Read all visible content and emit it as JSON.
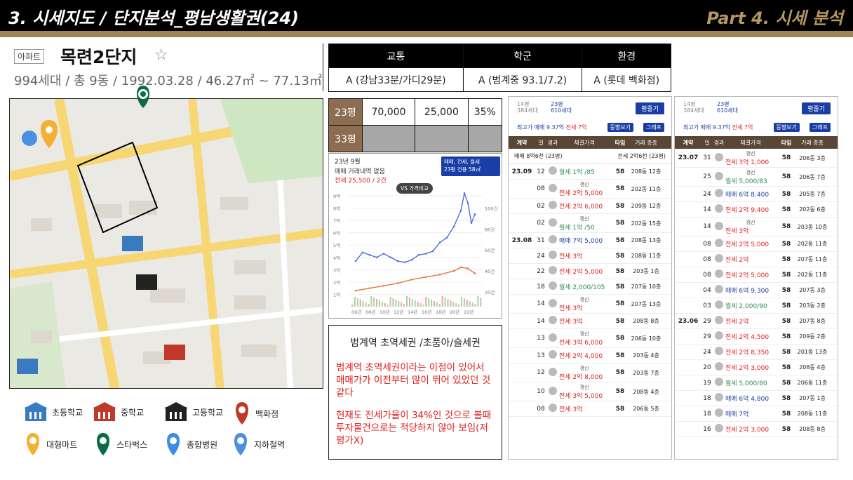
{
  "header": {
    "title": "3. 시세지도 / 단지분석_평남생활권(24)",
    "part": "Part 4. 시세 분석"
  },
  "apartment": {
    "type_badge": "아파트",
    "name": "목련2단지",
    "info": "994세대 / 총 9동 / 1992.03.28 / 46.27㎡ ~ 77.13㎡"
  },
  "grades": {
    "headers": [
      "교통",
      "학군",
      "환경"
    ],
    "values": [
      "A (강남33분/가디29분)",
      "A (범계중 93.1/7.2)",
      "A (롯데 백화점)"
    ]
  },
  "prices": [
    {
      "size": "23평",
      "sale": "70,000",
      "jeonse": "25,000",
      "ratio": "35%"
    },
    {
      "size": "33평",
      "sale": "",
      "jeonse": "",
      "ratio": ""
    }
  ],
  "chart_data": {
    "type": "line",
    "title": "23년 9월",
    "subtitle": "매매 거래내역 없음",
    "jeonse_note": "전세 25,500 / 2건",
    "button": "VS 가격비교",
    "filter": "매매, 전세, 월세",
    "filter_size": "23평",
    "filter_area": "전용 58㎡",
    "x_ticks": [
      "06년",
      "08년",
      "10년",
      "12년",
      "14년",
      "16년",
      "18년",
      "20년",
      "22년"
    ],
    "y_ticks": [
      "9억",
      "8억",
      "7억",
      "6억",
      "5억",
      "4억",
      "3억",
      "2억",
      "1억"
    ],
    "y2_ticks": [
      "100건",
      "80건",
      "60건",
      "40건",
      "20건"
    ],
    "series": [
      {
        "name": "매매",
        "color": "#4a6fdc",
        "x": [
          2006,
          2007,
          2008,
          2009,
          2010,
          2011,
          2012,
          2013,
          2014,
          2015,
          2016,
          2017,
          2018,
          2019,
          2020,
          2021,
          2021.5,
          2022,
          2022.5,
          2023
        ],
        "values": [
          3.7,
          4.4,
          4.2,
          4.0,
          4.3,
          4.0,
          3.7,
          3.6,
          3.8,
          4.2,
          4.3,
          4.5,
          5.2,
          5.6,
          6.5,
          7.8,
          9.2,
          8.4,
          6.8,
          7.5
        ]
      },
      {
        "name": "전세",
        "color": "#e8743b",
        "x": [
          2006,
          2008,
          2010,
          2012,
          2014,
          2016,
          2018,
          2020,
          2021,
          2022,
          2023
        ],
        "values": [
          1.3,
          1.5,
          1.7,
          1.9,
          2.2,
          2.4,
          2.6,
          2.9,
          3.2,
          3.1,
          2.7
        ]
      }
    ],
    "ylim": [
      0,
      9
    ],
    "xlim": [
      2005,
      2024
    ]
  },
  "summary": {
    "heading": "범계역 초역세권 /초품아/슬세권",
    "p1": "범계역 초역세권이라는 이점이 있어서 매매가가 이전부터 많이 뛰어 있었던 것 같다",
    "p2": "현재도 전세가율이 34%인 것으로 볼때 투자물건으로는 적당하지 않아 보임(저평가X)"
  },
  "legend": [
    {
      "label": "초등학교",
      "icon": "elementary-school-icon",
      "color": "#3a7bbf"
    },
    {
      "label": "중학교",
      "icon": "middle-school-icon",
      "color": "#c0392b"
    },
    {
      "label": "고등학교",
      "icon": "high-school-icon",
      "color": "#222222"
    },
    {
      "label": "백화점",
      "icon": "department-store-icon",
      "color": "#c0392b"
    },
    {
      "label": "대형마트",
      "icon": "mart-icon",
      "color": "#f2b134"
    },
    {
      "label": "스타벅스",
      "icon": "starbucks-icon",
      "color": "#0b6b45"
    },
    {
      "label": "종합병원",
      "icon": "hospital-icon",
      "color": "#3a8ee6"
    },
    {
      "label": "지하철역",
      "icon": "subway-icon",
      "color": "#4a90e2"
    }
  ],
  "panel_common": {
    "size": "14평",
    "households": "384세대",
    "py": "23평",
    "units": "610세대",
    "button": "평줄기",
    "maxp": "최고가 매매 9.37억",
    "jeonse7": "전세 7억",
    "btn1": "동별보기",
    "btn2": "그래프",
    "headers": [
      "계약",
      "일",
      "경과",
      "체결가격",
      "타입",
      "거래 층층"
    ]
  },
  "panel1": {
    "recent": [
      "매매 8억6천 (23평)",
      "전세 2억6천 (23평)"
    ],
    "rows": [
      {
        "m": "23.09",
        "d": "12",
        "tag": "",
        "type": "w",
        "text": "월세 1억 /85",
        "t": "58",
        "f": "208동 12층"
      },
      {
        "m": "",
        "d": "08",
        "tag": "갱신",
        "type": "j",
        "text": "전세 2억 5,000",
        "t": "58",
        "f": "202동 11층"
      },
      {
        "m": "",
        "d": "02",
        "tag": "",
        "type": "j",
        "text": "전세 2억 6,000",
        "t": "58",
        "f": "209동 12층"
      },
      {
        "m": "",
        "d": "02",
        "tag": "갱신",
        "type": "w",
        "text": "월세 1억 /50",
        "t": "58",
        "f": "202동 15층"
      },
      {
        "m": "23.08",
        "d": "31",
        "tag": "",
        "type": "m",
        "text": "매매 7억 5,000",
        "t": "58",
        "f": "208동 13층"
      },
      {
        "m": "",
        "d": "24",
        "tag": "",
        "type": "j",
        "text": "전세 3억",
        "t": "58",
        "f": "208동 11층"
      },
      {
        "m": "",
        "d": "22",
        "tag": "",
        "type": "j",
        "text": "전세 2억 5,000",
        "t": "58",
        "f": "203동 1층"
      },
      {
        "m": "",
        "d": "18",
        "tag": "",
        "type": "w",
        "text": "월세 2,000/105",
        "t": "58",
        "f": "207동 10층"
      },
      {
        "m": "",
        "d": "14",
        "tag": "갱신",
        "type": "j",
        "text": "전세 3억",
        "t": "58",
        "f": "207동 13층"
      },
      {
        "m": "",
        "d": "14",
        "tag": "",
        "type": "j",
        "text": "전세 3억",
        "t": "58",
        "f": "208동 8층"
      },
      {
        "m": "",
        "d": "13",
        "tag": "갱신",
        "type": "j",
        "text": "전세 3억 6,000",
        "t": "58",
        "f": "206동 10층"
      },
      {
        "m": "",
        "d": "13",
        "tag": "",
        "type": "j",
        "text": "전세 2억 4,000",
        "t": "58",
        "f": "203동 4층"
      },
      {
        "m": "",
        "d": "12",
        "tag": "갱신",
        "type": "j",
        "text": "전세 2억 8,000",
        "t": "58",
        "f": "203동 7층"
      },
      {
        "m": "",
        "d": "10",
        "tag": "갱신",
        "type": "j",
        "text": "전세 3억 5,000",
        "t": "58",
        "f": "208동 4층"
      },
      {
        "m": "",
        "d": "08",
        "tag": "",
        "type": "j",
        "text": "전세 3억",
        "t": "58",
        "f": "206동 5층"
      }
    ]
  },
  "panel2": {
    "rows": [
      {
        "m": "23.07",
        "d": "31",
        "tag": "갱신",
        "type": "j",
        "text": "전세 3억 1,000",
        "t": "58",
        "f": "206동 3층"
      },
      {
        "m": "",
        "d": "25",
        "tag": "갱신",
        "type": "w",
        "text": "월세 5,000/83",
        "t": "58",
        "f": "206동 7층"
      },
      {
        "m": "",
        "d": "24",
        "tag": "",
        "type": "m",
        "text": "매매 6억 8,400",
        "t": "58",
        "f": "205동 7층"
      },
      {
        "m": "",
        "d": "14",
        "tag": "",
        "type": "j",
        "text": "전세 2억 9,400",
        "t": "58",
        "f": "202동 6층"
      },
      {
        "m": "",
        "d": "14",
        "tag": "갱신",
        "type": "j",
        "text": "전세 3억",
        "t": "58",
        "f": "203동 10층"
      },
      {
        "m": "",
        "d": "08",
        "tag": "",
        "type": "j",
        "text": "전세 2억 5,000",
        "t": "58",
        "f": "202동 11층"
      },
      {
        "m": "",
        "d": "08",
        "tag": "",
        "type": "j",
        "text": "전세 2억",
        "t": "58",
        "f": "207동 11층"
      },
      {
        "m": "",
        "d": "08",
        "tag": "",
        "type": "j",
        "text": "전세 2억 5,000",
        "t": "58",
        "f": "202동 11층"
      },
      {
        "m": "",
        "d": "04",
        "tag": "",
        "type": "m",
        "text": "매매 6억 9,300",
        "t": "58",
        "f": "207동 3층"
      },
      {
        "m": "",
        "d": "03",
        "tag": "",
        "type": "w",
        "text": "월세 2,000/90",
        "t": "58",
        "f": "203동 2층"
      },
      {
        "m": "23.06",
        "d": "29",
        "tag": "",
        "type": "j",
        "text": "전세 2억",
        "t": "58",
        "f": "207동 8층"
      },
      {
        "m": "",
        "d": "29",
        "tag": "",
        "type": "j",
        "text": "전세 2억 4,500",
        "t": "58",
        "f": "209동 2층"
      },
      {
        "m": "",
        "d": "24",
        "tag": "",
        "type": "j",
        "text": "전세 2억 8,350",
        "t": "58",
        "f": "201동 13층"
      },
      {
        "m": "",
        "d": "20",
        "tag": "",
        "type": "j",
        "text": "전세 2억 3,000",
        "t": "58",
        "f": "208동 4층"
      },
      {
        "m": "",
        "d": "19",
        "tag": "",
        "type": "w",
        "text": "월세 5,000/80",
        "t": "58",
        "f": "206동 11층"
      },
      {
        "m": "",
        "d": "18",
        "tag": "",
        "type": "m",
        "text": "매매 6억 4,800",
        "t": "58",
        "f": "207동 1층"
      },
      {
        "m": "",
        "d": "18",
        "tag": "",
        "type": "m",
        "text": "매매 7억",
        "t": "58",
        "f": "208동 11층"
      },
      {
        "m": "",
        "d": "16",
        "tag": "",
        "type": "j",
        "text": "전세 2억 3,000",
        "t": "58",
        "f": "208동 8층"
      }
    ]
  }
}
